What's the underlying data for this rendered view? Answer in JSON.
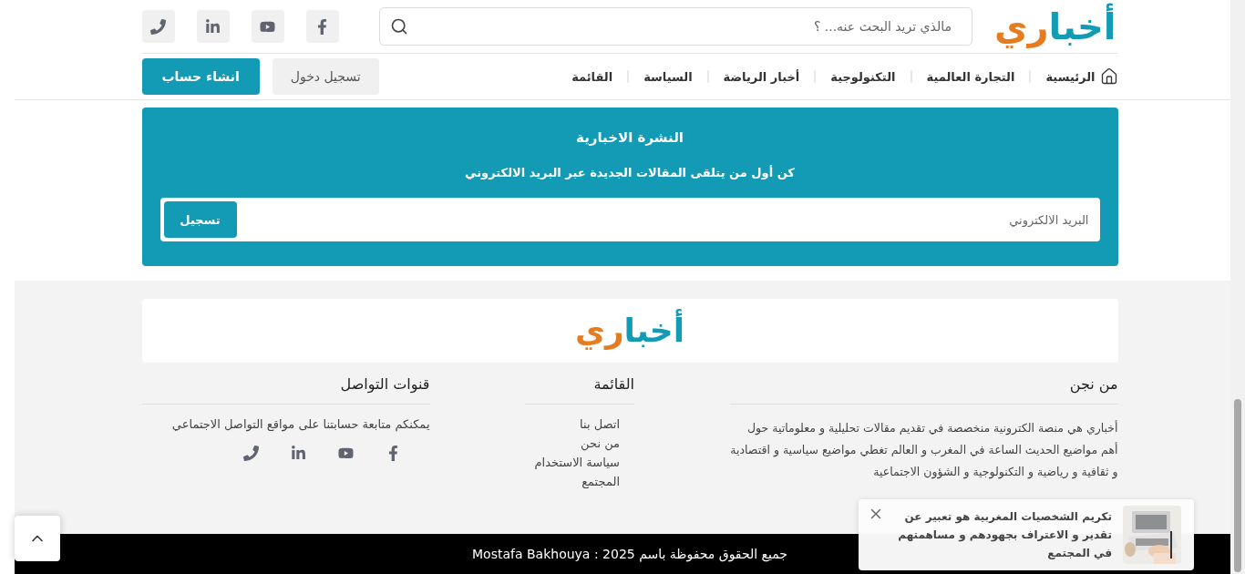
{
  "header": {
    "logo": {
      "lead": "أخبا",
      "tail": "ري"
    },
    "search": {
      "placeholder": "مالذي تريد البحث عنه... ؟"
    },
    "social": [
      {
        "kind": "facebook"
      },
      {
        "kind": "youtube"
      },
      {
        "kind": "linkedin"
      },
      {
        "kind": "phone"
      }
    ]
  },
  "nav": {
    "items": [
      {
        "label": "الرئيسية"
      },
      {
        "label": "التجارة العالمية"
      },
      {
        "label": "التكنولوجية"
      },
      {
        "label": "أخبار الرياضة"
      },
      {
        "label": "السياسة"
      },
      {
        "label": "القائمة"
      }
    ],
    "login": "تسجيل دخول",
    "signup": "انشاء حساب"
  },
  "newsletter": {
    "title": "النشرة الاخبارية",
    "subtitle": "كن أول من يتلقى المقالات الجديدة عبر البريد الالكتروني",
    "placeholder": "البريد الالكتروني",
    "button": "تسجيل"
  },
  "footer": {
    "logo": {
      "lead": "أخبا",
      "tail": "ري"
    },
    "about": {
      "title": "من نجن",
      "text": "أخباري هي منصة الكترونية منخصصة في تقديم مقالات تحليلية و معلوماتية حول أهم مواضيع الحديث الساعة في المغرب و العالم تغطي مواضيع سياسية و اقتصادية و ثقافية و رياضية و التكنولوجية و الشؤون الاجتماعية"
    },
    "menu": {
      "title": "القائمة",
      "links": [
        "اتصل بنا",
        "من نحن",
        "سياسة الاستخدام",
        "المجتمع"
      ]
    },
    "contact": {
      "title": "قنوات التواصل",
      "text": "يمكنكم متابعة حسابتنا على مواقع التواصل الاجتماعي",
      "social": [
        {
          "kind": "facebook"
        },
        {
          "kind": "youtube"
        },
        {
          "kind": "linkedin"
        },
        {
          "kind": "phone"
        }
      ]
    },
    "copyright": "جميع الحقوق محفوظة باسم 2025 : Mostafa Bakhouya"
  },
  "toast": {
    "text": "تكريم الشخصيات المغربية هو تعبير عن تقدير و الاعتراف بجهودهم و مساهمتهم في المجتمع"
  }
}
